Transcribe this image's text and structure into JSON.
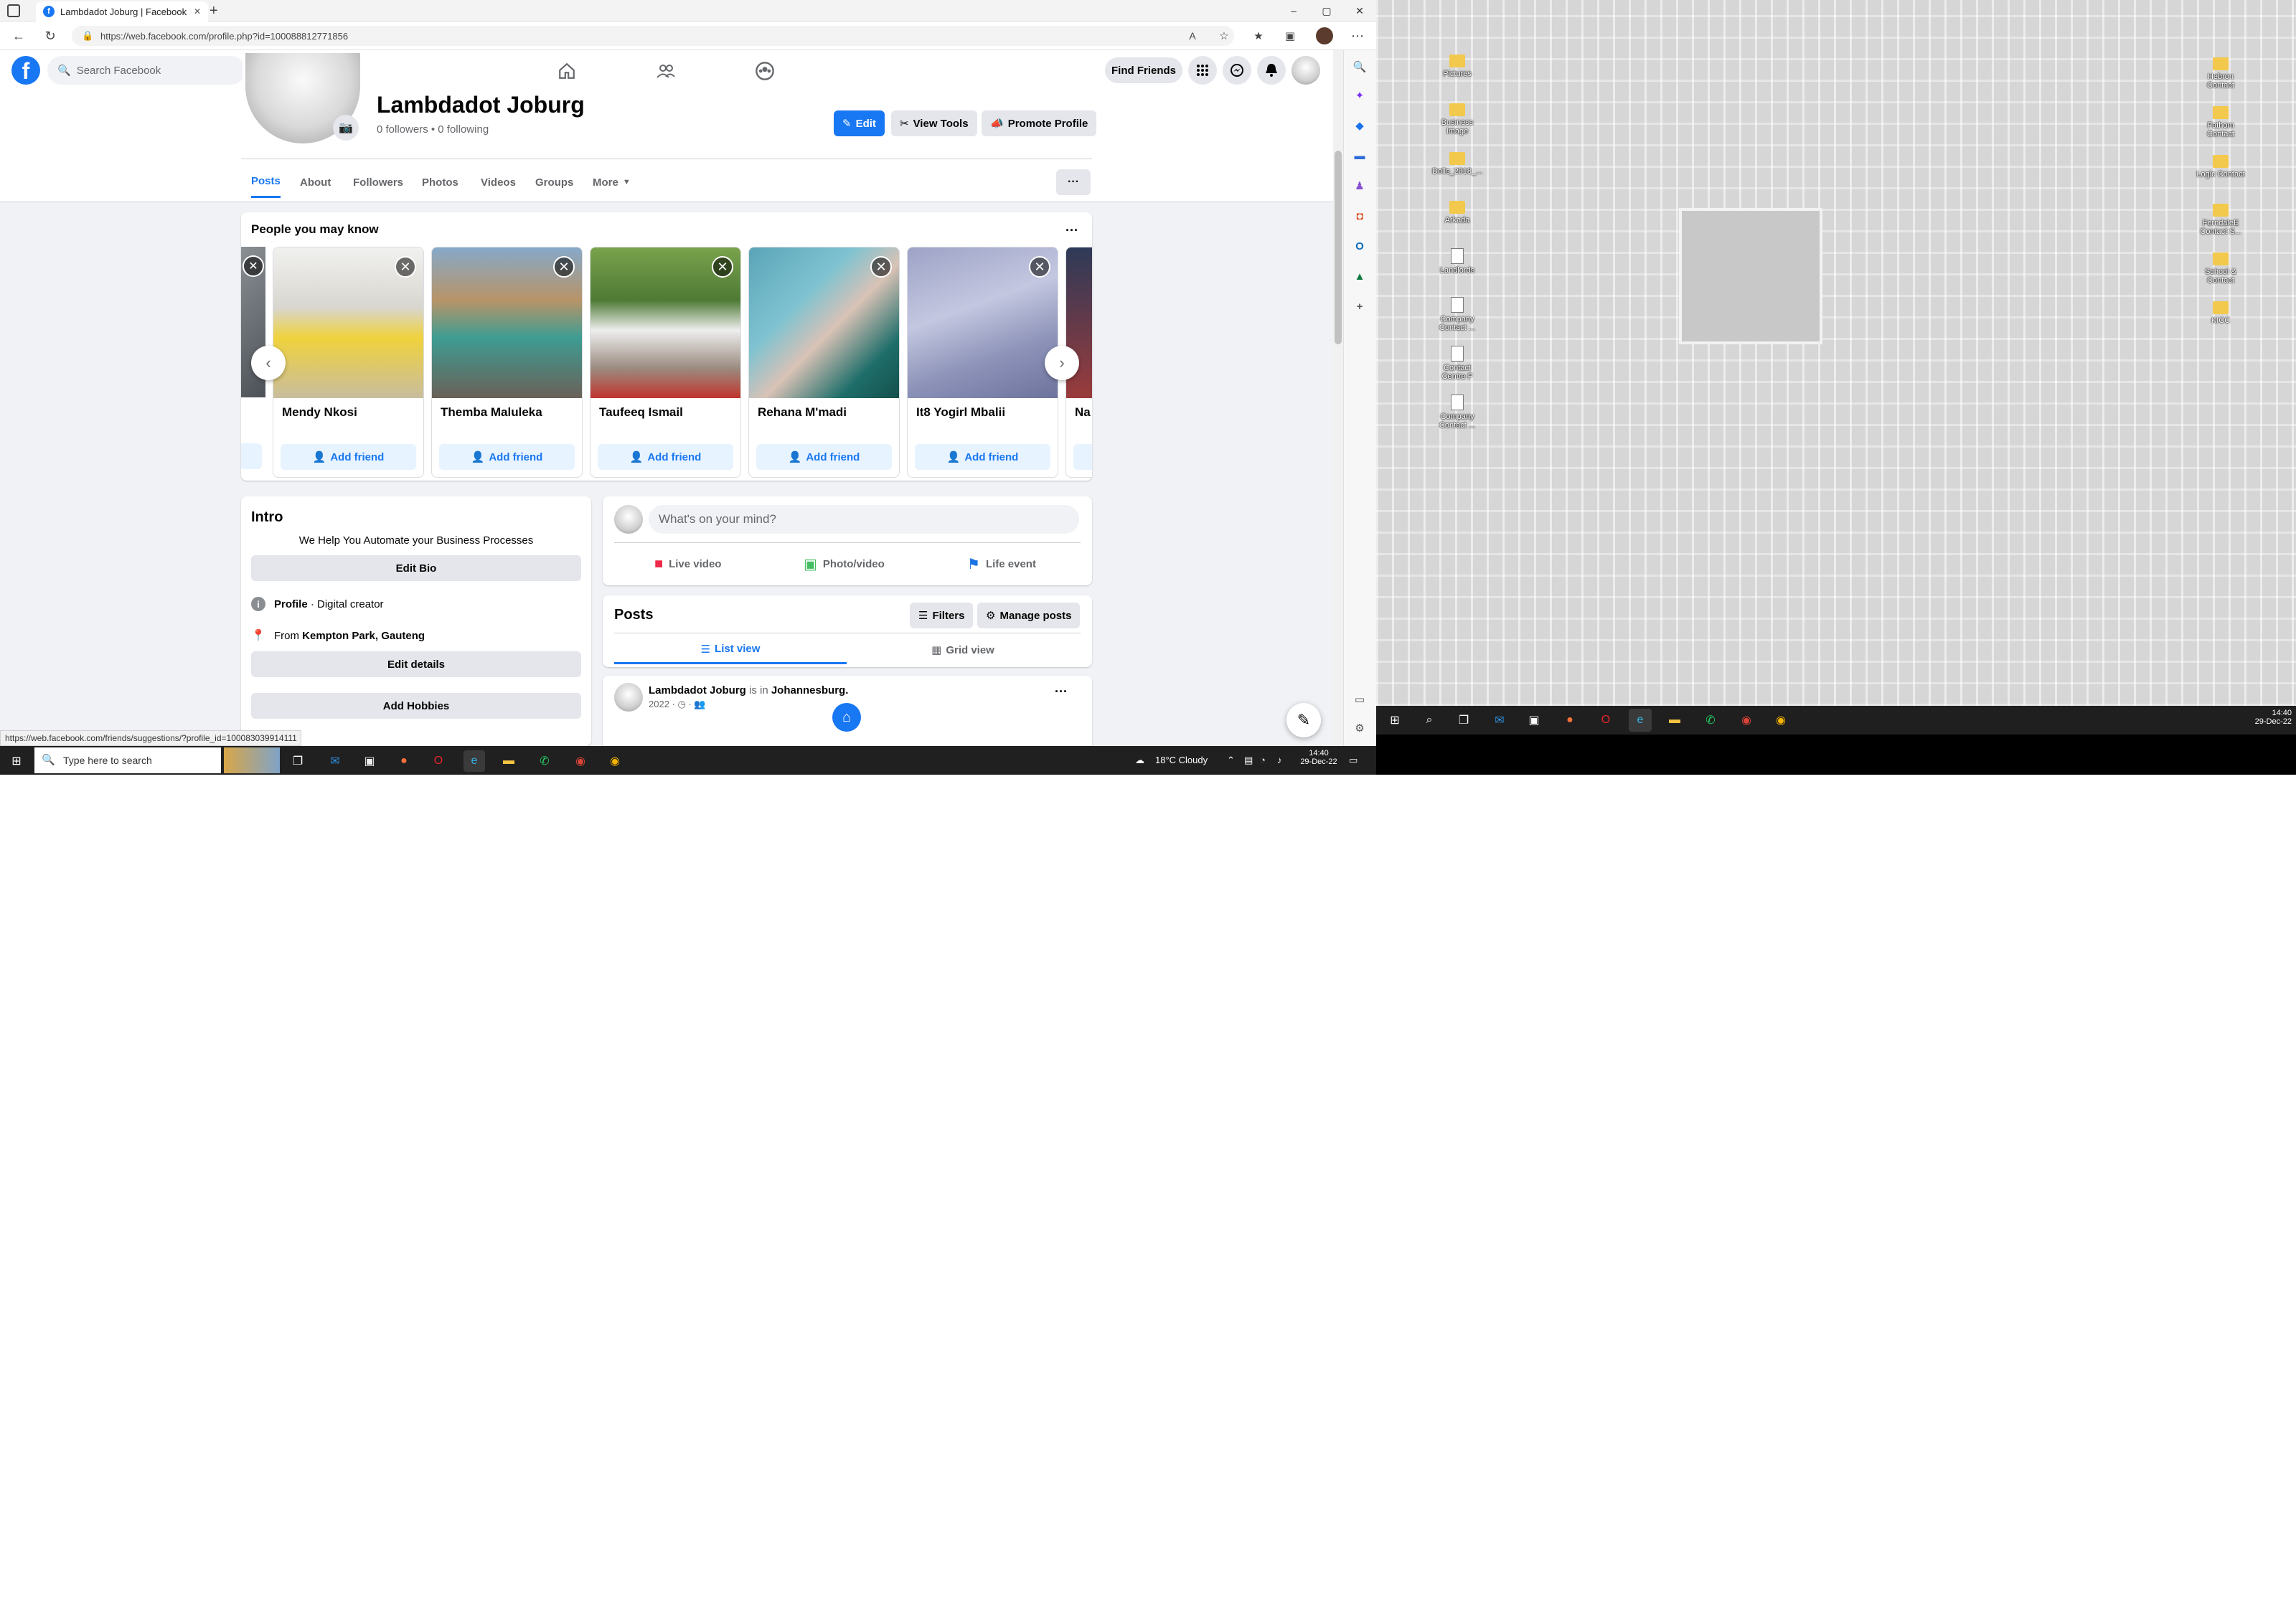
{
  "browser": {
    "tab_title": "Lambdadot Joburg | Facebook",
    "new_tab": "+",
    "url": "https://web.facebook.com/profile.php?id=100088812771856",
    "status_url": "https://web.facebook.com/friends/suggestions/?profile_id=100083039914111",
    "window_controls": [
      "–",
      "▢",
      "✕"
    ]
  },
  "fb_nav": {
    "logo": "f",
    "search_placeholder": "Search Facebook",
    "find_friends": "Find Friends"
  },
  "profile": {
    "name": "Lambdadot Joburg",
    "meta": "0 followers • 0 following",
    "buttons": {
      "edit": "Edit",
      "view_tools": "View Tools",
      "promote": "Promote Profile"
    },
    "tabs": [
      "Posts",
      "About",
      "Followers",
      "Photos",
      "Videos",
      "Groups",
      "More"
    ],
    "more_dots": "···"
  },
  "pymk": {
    "title": "People you may know",
    "people": [
      {
        "name": "Mendy Nkosi",
        "add": "Add friend"
      },
      {
        "name": "Themba Maluleka",
        "add": "Add friend"
      },
      {
        "name": "Taufeeq Ismail",
        "add": "Add friend"
      },
      {
        "name": "Rehana M'madi",
        "add": "Add friend"
      },
      {
        "name": "It8 Yogirl Mbalii",
        "add": "Add friend"
      },
      {
        "name": "Na",
        "add": ""
      }
    ]
  },
  "intro": {
    "title": "Intro",
    "bio": "We Help You Automate your Business Processes",
    "edit_bio": "Edit Bio",
    "profile_label": "Profile",
    "profile_value": " · Digital creator",
    "from_label": "From ",
    "from_value": "Kempton Park, Gauteng",
    "edit_details": "Edit details",
    "add_hobbies": "Add Hobbies"
  },
  "composer": {
    "placeholder": "What's on your mind?",
    "live": "Live video",
    "photo": "Photo/video",
    "life": "Life event"
  },
  "posts": {
    "title": "Posts",
    "filters": "Filters",
    "manage": "Manage posts",
    "list_view": "List view",
    "grid_view": "Grid view",
    "author": "Lambdadot Joburg",
    "is_in": " is in ",
    "place": "Johannesburg.",
    "date": "2022 · ◷ · 👥"
  },
  "taskbar_left": {
    "search_placeholder": "Type here to search",
    "weather": "18°C  Cloudy",
    "time": "14:40",
    "date": "29-Dec-22"
  },
  "desktop": {
    "icons_col1": [
      "Pictures",
      "Business Image",
      "Dolls_2018_...",
      "Arkada",
      "Landlords",
      "Company Contact ...",
      "Contact Centre F",
      "Company Contact ..."
    ],
    "icons_col2": [
      "Hebron Contact",
      "Fathom Contact",
      "Logic Contact",
      "FerndaleE Contact S...",
      "School & Contact",
      "KICC"
    ],
    "time": "14:40",
    "date": "29-Dec-22"
  },
  "colors": {
    "fb_blue": "#1877f2",
    "fb_bg": "#f0f2f5",
    "light_blue_btn": "#e7f3ff",
    "taskbar": "#202020"
  }
}
